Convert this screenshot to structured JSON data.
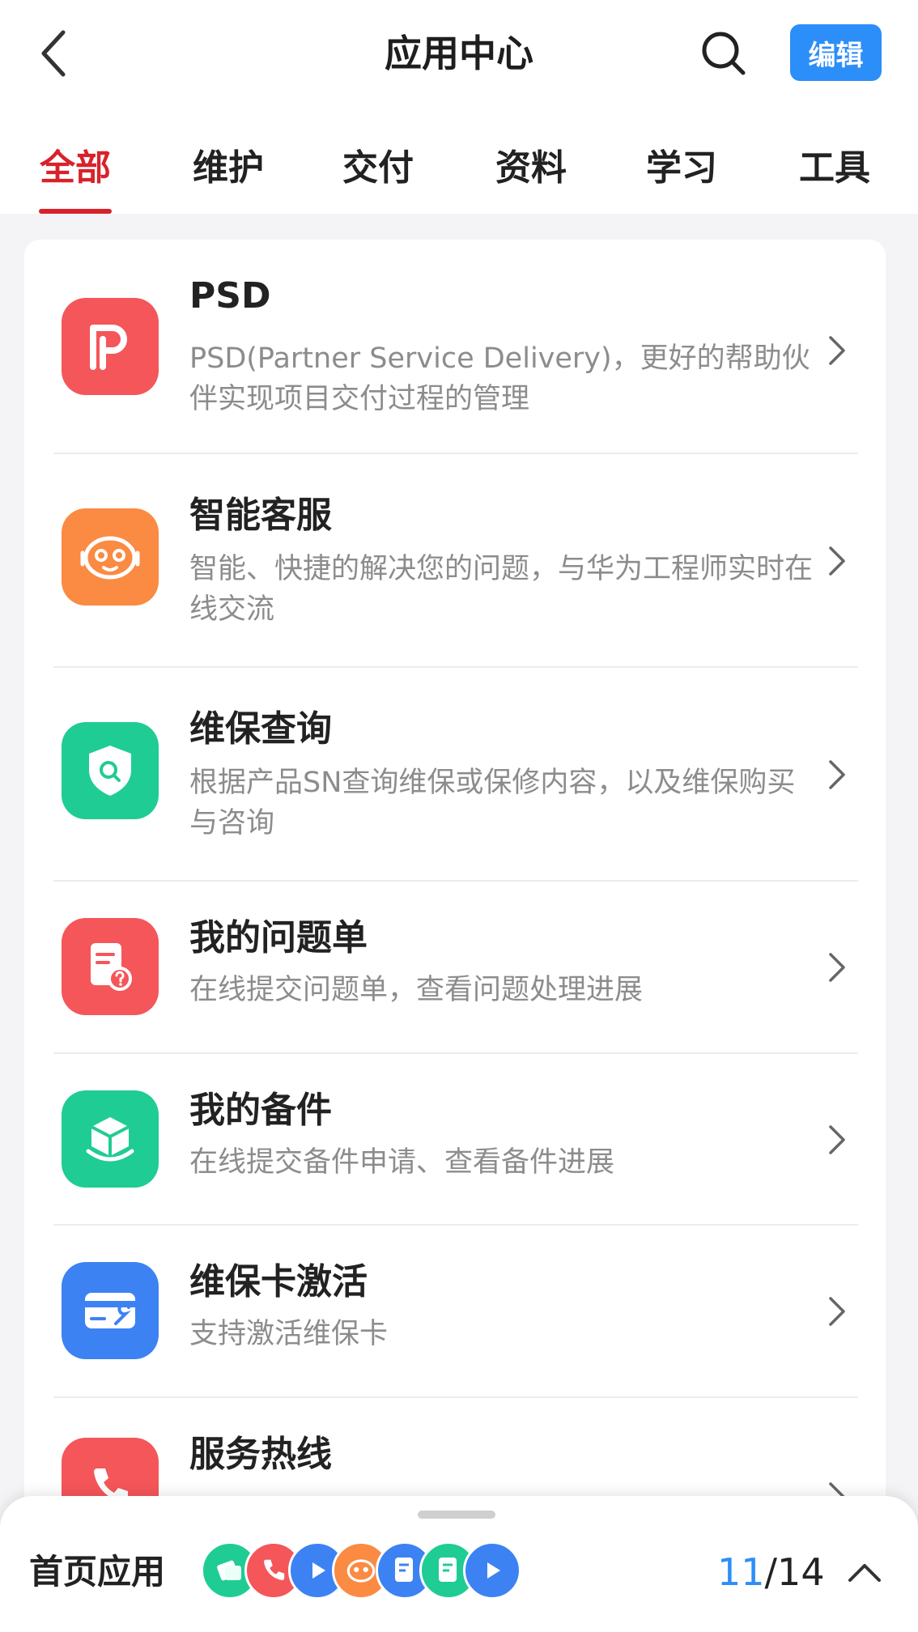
{
  "header": {
    "title": "应用中心",
    "edit_label": "编辑",
    "icons": {
      "back": "back-arrow-icon",
      "search": "search-icon"
    }
  },
  "tabs": [
    {
      "label": "全部",
      "active": true
    },
    {
      "label": "维护",
      "active": false
    },
    {
      "label": "交付",
      "active": false
    },
    {
      "label": "资料",
      "active": false
    },
    {
      "label": "学习",
      "active": false
    },
    {
      "label": "工具",
      "active": false
    }
  ],
  "apps": [
    {
      "name": "PSD",
      "desc": "PSD(Partner Service Delivery)，更好的帮助伙伴实现项目交付过程的管理",
      "icon": "psd-logo-icon",
      "color": "#f4565a"
    },
    {
      "name": "智能客服",
      "desc": "智能、快捷的解决您的问题，与华为工程师实时在线交流",
      "icon": "robot-icon",
      "color": "#fb8a43"
    },
    {
      "name": "维保查询",
      "desc": "根据产品SN查询维保或保修内容，以及维保购买与咨询",
      "icon": "shield-search-icon",
      "color": "#1fcc94"
    },
    {
      "name": "我的问题单",
      "desc": "在线提交问题单，查看问题处理进展",
      "icon": "question-doc-icon",
      "color": "#f4565a"
    },
    {
      "name": "我的备件",
      "desc": "在线提交备件申请、查看备件进展",
      "icon": "cube-icon",
      "color": "#1fcc94"
    },
    {
      "name": "维保卡激活",
      "desc": "支持激活维保卡",
      "icon": "card-wrench-icon",
      "color": "#3d82f3"
    },
    {
      "name": "服务热线",
      "desc": "",
      "icon": "phone-icon",
      "color": "#f4565a"
    }
  ],
  "bottom": {
    "label": "首页应用",
    "current": "11",
    "separator": "/",
    "total": "14",
    "mini_icons": [
      "books-icon",
      "phone-icon",
      "play-icon",
      "robot-icon",
      "doc-icon",
      "doc-icon",
      "play-icon"
    ]
  }
}
